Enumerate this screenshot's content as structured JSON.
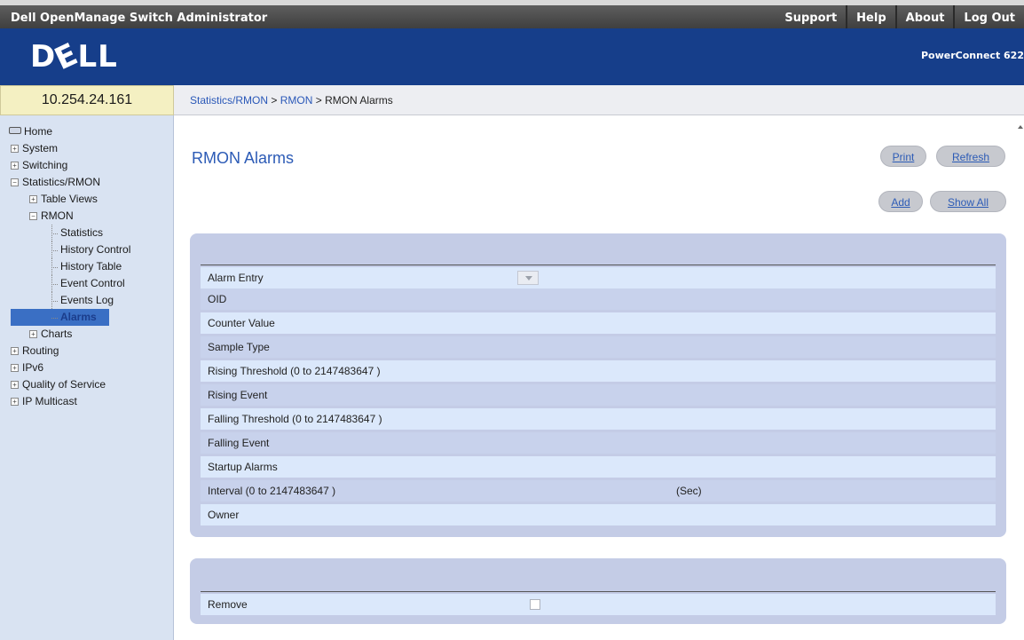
{
  "app": {
    "title": "Dell OpenManage Switch Administrator",
    "top_links": [
      "Support",
      "Help",
      "About",
      "Log Out"
    ],
    "logo": {
      "d": "D",
      "e": "E",
      "ll": "LL"
    },
    "model": "PowerConnect 622"
  },
  "ip_address": "10.254.24.161",
  "breadcrumb": {
    "level1": "Statistics/RMON",
    "sep1": " > ",
    "level2": "RMON",
    "sep2": " > ",
    "current": "RMON Alarms"
  },
  "sidebar": {
    "items": [
      {
        "label": "Home"
      },
      {
        "label": "System",
        "expander": "+"
      },
      {
        "label": "Switching",
        "expander": "+"
      },
      {
        "label": "Statistics/RMON",
        "expander": "−"
      },
      {
        "label": "Table Views",
        "expander": "+"
      },
      {
        "label": "RMON",
        "expander": "−"
      },
      {
        "label": "Statistics"
      },
      {
        "label": "History Control"
      },
      {
        "label": "History Table"
      },
      {
        "label": "Event Control"
      },
      {
        "label": "Events Log"
      },
      {
        "label": "Alarms"
      },
      {
        "label": "Charts",
        "expander": "+"
      },
      {
        "label": "Routing",
        "expander": "+"
      },
      {
        "label": "IPv6",
        "expander": "+"
      },
      {
        "label": "Quality of Service",
        "expander": "+"
      },
      {
        "label": "IP Multicast",
        "expander": "+"
      }
    ]
  },
  "main": {
    "title": "RMON Alarms",
    "buttons": {
      "print": "Print",
      "refresh": "Refresh",
      "add": "Add",
      "show_all": "Show All"
    },
    "fields": [
      {
        "label": "Alarm Entry"
      },
      {
        "label": "OID"
      },
      {
        "label": "Counter Value"
      },
      {
        "label": "Sample Type"
      },
      {
        "label": "Rising Threshold (0 to 2147483647 )"
      },
      {
        "label": "Rising Event"
      },
      {
        "label": "Falling Threshold (0 to 2147483647 )"
      },
      {
        "label": "Falling Event"
      },
      {
        "label": "Startup Alarms"
      },
      {
        "label": "Interval (0 to 2147483647 )",
        "unit": "(Sec)"
      },
      {
        "label": "Owner"
      }
    ],
    "remove_label": "Remove"
  }
}
